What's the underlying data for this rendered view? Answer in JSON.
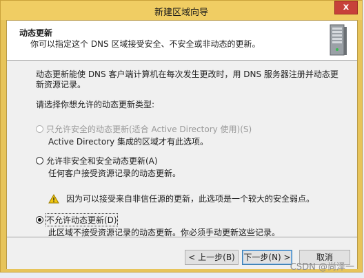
{
  "window": {
    "title": "新建区域向导",
    "close_label": "x"
  },
  "header": {
    "title": "动态更新",
    "subtitle": "你可以指定这个 DNS 区域接受安全、不安全或非动态的更新。"
  },
  "content": {
    "intro": "动态更新能使 DNS 客户端计算机在每次发生更改时，用 DNS 服务器注册并动态更新资源记录。",
    "prompt": "请选择你想允许的动态更新类型:",
    "options": [
      {
        "label": "只允许安全的动态更新(适合 Active Directory 使用)(S)",
        "description": "Active Directory 集成的区域才有此选项。",
        "enabled": false,
        "selected": false
      },
      {
        "label": "允许非安全和安全动态更新(A)",
        "description": "任何客户接受资源记录的动态更新。",
        "warning": "因为可以接受来自非信任源的更新，此选项是一个较大的安全弱点。",
        "enabled": true,
        "selected": false
      },
      {
        "label": "不允许动态更新(D)",
        "description": "此区域不接受资源记录的动态更新。你必须手动更新这些记录。",
        "enabled": true,
        "selected": true
      }
    ]
  },
  "footer": {
    "back_label": "< 上一步(B)",
    "next_label": "下一步(N) >",
    "cancel_label": "取消"
  },
  "watermark": "CSDN @尚泽一",
  "colors": {
    "titlebar": "#f0cd63",
    "close": "#c7413a",
    "warning": "#f2c811"
  }
}
